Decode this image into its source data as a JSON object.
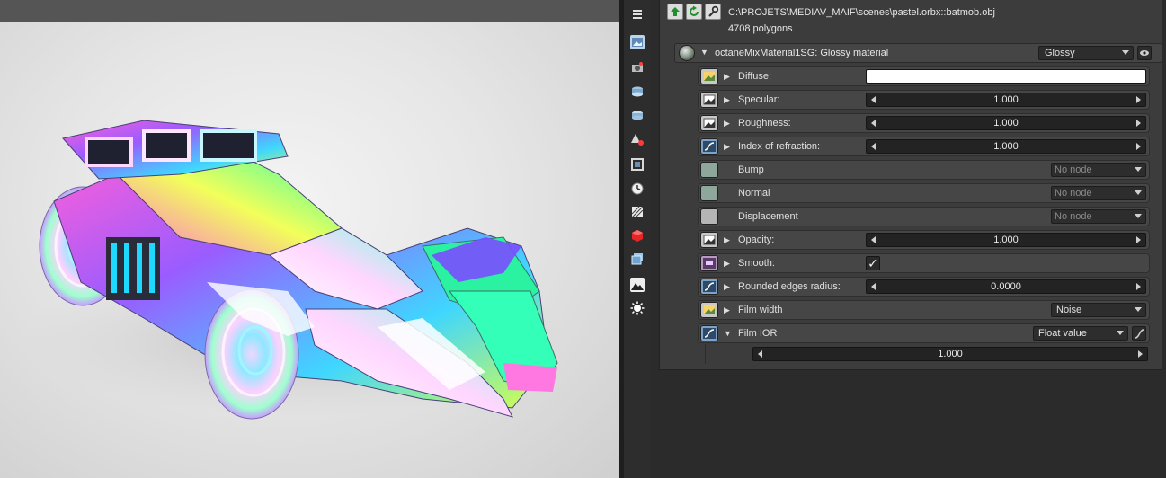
{
  "mesh": {
    "path": "C:\\PROJETS\\MEDIAV_MAIF\\scenes\\pastel.orbx::batmob.obj",
    "polygons": "4708 polygons"
  },
  "material": {
    "title": "octaneMixMaterial1SG: Glossy material",
    "type": "Glossy"
  },
  "params": [
    {
      "label": "Diffuse:",
      "kind": "color",
      "color": "#ffffff",
      "icon": "texture-icon"
    },
    {
      "label": "Specular:",
      "kind": "slider",
      "value": "1.000",
      "icon": "texture-icon"
    },
    {
      "label": "Roughness:",
      "kind": "slider",
      "value": "1.000",
      "icon": "texture-icon"
    },
    {
      "label": "Index of refraction:",
      "kind": "slider",
      "value": "1.000",
      "icon": "float-curve-icon"
    },
    {
      "label": "Bump",
      "kind": "node",
      "value": "No node",
      "icon": "empty-slot-icon"
    },
    {
      "label": "Normal",
      "kind": "node",
      "value": "No node",
      "icon": "empty-slot-icon"
    },
    {
      "label": "Displacement",
      "kind": "node",
      "value": "No node",
      "icon": "empty-slot-icon"
    },
    {
      "label": "Opacity:",
      "kind": "slider",
      "value": "1.000",
      "icon": "texture-icon"
    },
    {
      "label": "Smooth:",
      "kind": "check",
      "value": "✓",
      "icon": "bool-icon"
    },
    {
      "label": "Rounded edges radius:",
      "kind": "slider",
      "value": "0.0000",
      "icon": "float-curve-icon"
    },
    {
      "label": "Film width",
      "kind": "dropdown",
      "value": "Noise",
      "icon": "texture-icon"
    },
    {
      "label": "Film IOR",
      "kind": "dropdown",
      "value": "Float value",
      "icon": "float-curve-icon"
    }
  ],
  "film_ior_value": "1.000"
}
